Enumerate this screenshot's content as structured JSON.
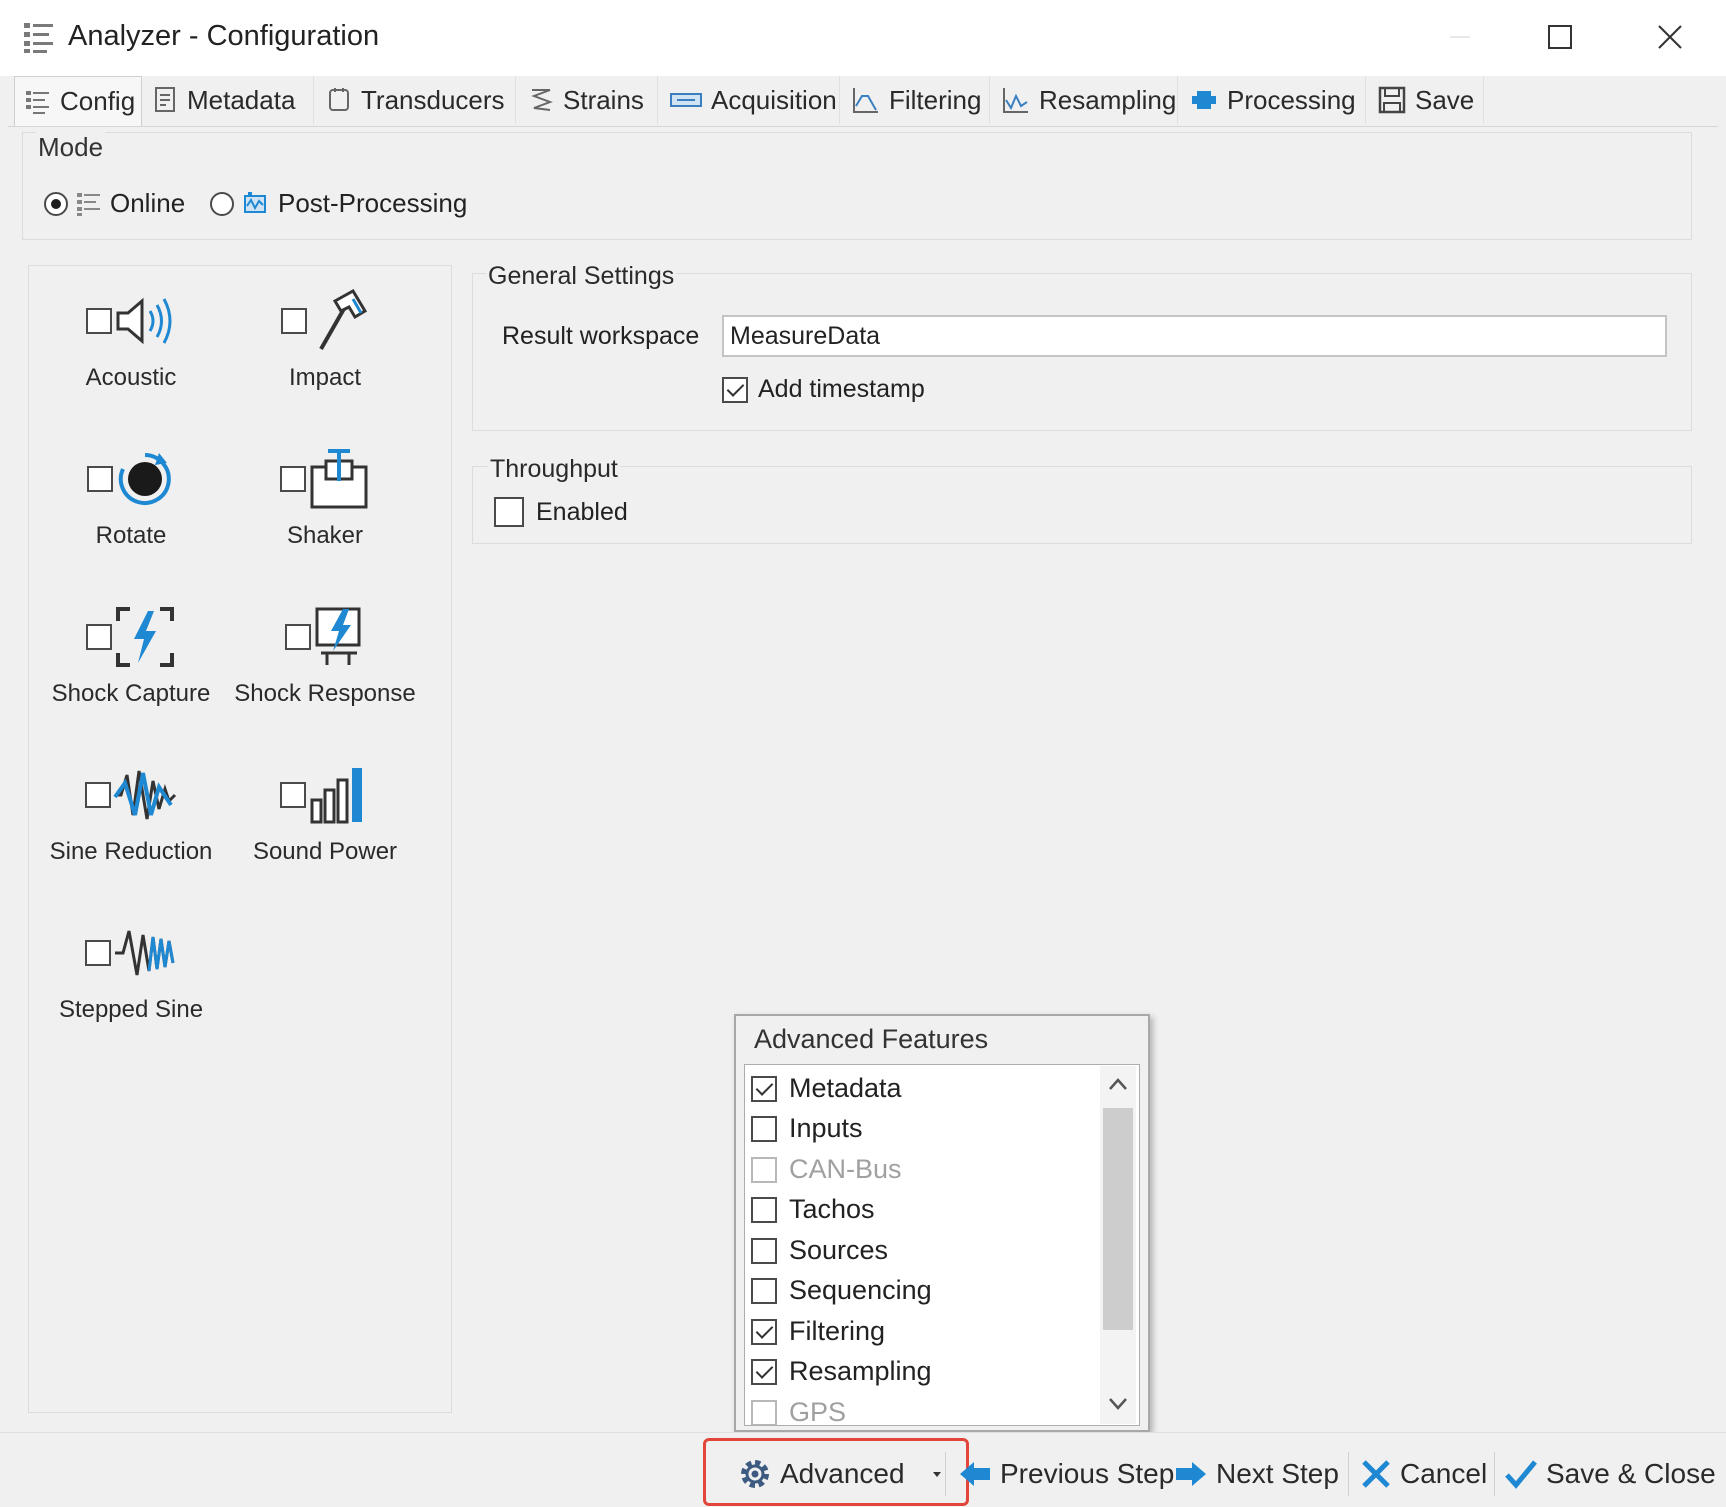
{
  "window": {
    "title": "Analyzer - Configuration",
    "controls": [
      "minimize",
      "maximize",
      "close"
    ]
  },
  "tabs": [
    {
      "label": "Config",
      "icon": "config-list-icon",
      "active": true
    },
    {
      "label": "Metadata",
      "icon": "metadata-icon",
      "active": false
    },
    {
      "label": "Transducers",
      "icon": "transducers-icon",
      "active": false
    },
    {
      "label": "Strains",
      "icon": "strains-icon",
      "active": false
    },
    {
      "label": "Acquisition",
      "icon": "acquisition-icon",
      "active": false
    },
    {
      "label": "Filtering",
      "icon": "filtering-icon",
      "active": false
    },
    {
      "label": "Resampling",
      "icon": "resampling-icon",
      "active": false
    },
    {
      "label": "Processing",
      "icon": "processing-icon",
      "active": false
    },
    {
      "label": "Save",
      "icon": "save-icon",
      "active": false
    }
  ],
  "mode": {
    "label": "Mode",
    "options": [
      {
        "label": "Online",
        "selected": true
      },
      {
        "label": "Post-Processing",
        "selected": false
      }
    ]
  },
  "features": [
    {
      "label": "Acoustic",
      "checked": false,
      "icon": "speaker-icon"
    },
    {
      "label": "Impact",
      "checked": false,
      "icon": "hammer-icon"
    },
    {
      "label": "Rotate",
      "checked": false,
      "icon": "rotate-icon"
    },
    {
      "label": "Shaker",
      "checked": false,
      "icon": "shaker-icon"
    },
    {
      "label": "Shock Capture",
      "checked": false,
      "icon": "shock-capture-icon"
    },
    {
      "label": "Shock Response",
      "checked": false,
      "icon": "shock-response-icon"
    },
    {
      "label": "Sine Reduction",
      "checked": false,
      "icon": "sine-reduction-icon"
    },
    {
      "label": "Sound Power",
      "checked": false,
      "icon": "sound-power-icon"
    },
    {
      "label": "Stepped Sine",
      "checked": false,
      "icon": "stepped-sine-icon"
    }
  ],
  "general": {
    "label": "General Settings",
    "workspace_label": "Result workspace",
    "workspace_value": "MeasureData",
    "timestamp_label": "Add timestamp",
    "timestamp_checked": true
  },
  "throughput": {
    "label": "Throughput",
    "enabled_label": "Enabled",
    "enabled_checked": false
  },
  "advanced_popup": {
    "title": "Advanced Features",
    "items": [
      {
        "label": "Metadata",
        "checked": true,
        "disabled": false
      },
      {
        "label": "Inputs",
        "checked": false,
        "disabled": false
      },
      {
        "label": "CAN-Bus",
        "checked": false,
        "disabled": true
      },
      {
        "label": "Tachos",
        "checked": false,
        "disabled": false
      },
      {
        "label": "Sources",
        "checked": false,
        "disabled": false
      },
      {
        "label": "Sequencing",
        "checked": false,
        "disabled": false
      },
      {
        "label": "Filtering",
        "checked": true,
        "disabled": false
      },
      {
        "label": "Resampling",
        "checked": true,
        "disabled": false
      },
      {
        "label": "GPS",
        "checked": false,
        "disabled": true
      }
    ]
  },
  "bottom": {
    "advanced": "Advanced",
    "previous": "Previous Step",
    "next": "Next Step",
    "cancel": "Cancel",
    "save_close": "Save & Close"
  },
  "colors": {
    "accent_blue": "#1e88d2",
    "highlight_red": "#e2453a",
    "check_blue": "#1e88d2"
  }
}
